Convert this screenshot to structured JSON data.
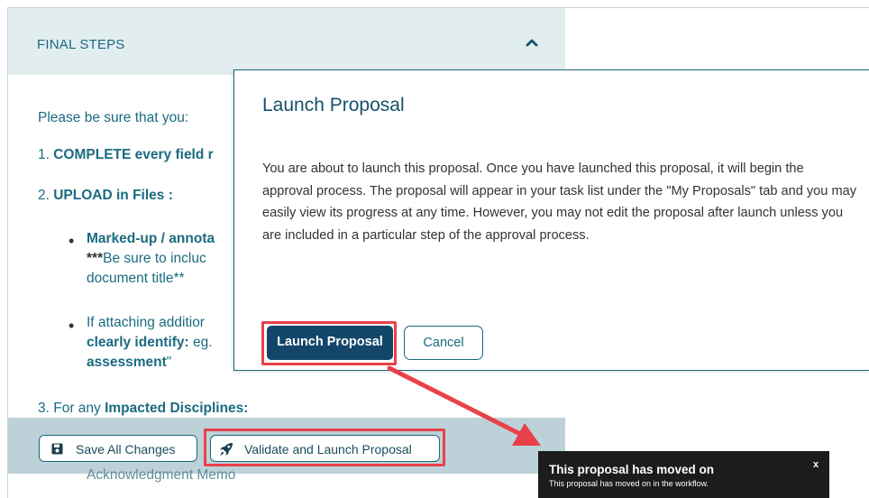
{
  "panel": {
    "title": "FINAL STEPS",
    "intro": "Please be sure that you:",
    "step1_num": "1. ",
    "step1_bold": "COMPLETE every field r",
    "step2_num": "2. ",
    "step2_bold": "UPLOAD in Files :",
    "bullet1_bold": "Marked-up / annota",
    "bullet1_stars": "***",
    "bullet1_line2": "Be sure to incluc",
    "bullet1_line3": "document title**",
    "bullet2_line1": "If attaching additior",
    "bullet2_bold": "clearly identify:",
    "bullet2_rest": " eg.",
    "bullet2_line3_bold": "assessment",
    "bullet2_line3_rest": "\"",
    "step3_num": "3. F",
    "step3_mid": "or any ",
    "step3_bold": "Impacted Disciplines:",
    "memo_partial": "Acknowledgment Memo"
  },
  "toolbar": {
    "save_label": "Save All Changes",
    "validate_label": "Validate and Launch Proposal"
  },
  "modal": {
    "title": "Launch Proposal",
    "body": "You are about to launch this proposal. Once you have launched this proposal, it will begin the approval process. The proposal will appear in your task list under the \"My Proposals\" tab and you may easily view its progress at any time. However, you may not edit the proposal after launch unless you are included in a particular step of the approval process.",
    "launch_label": "Launch Proposal",
    "cancel_label": "Cancel"
  },
  "toast": {
    "title": "This proposal has moved on",
    "message": "This proposal has moved on in the workflow.",
    "close": "x"
  },
  "colors": {
    "accent": "#1a6b80",
    "primary_button": "#14466a",
    "highlight": "#e8414a",
    "toast_bg": "#1c1c1c"
  },
  "icons": [
    "chevron-up-icon",
    "save-icon",
    "rocket-icon",
    "close-icon",
    "arrow-annotation"
  ]
}
